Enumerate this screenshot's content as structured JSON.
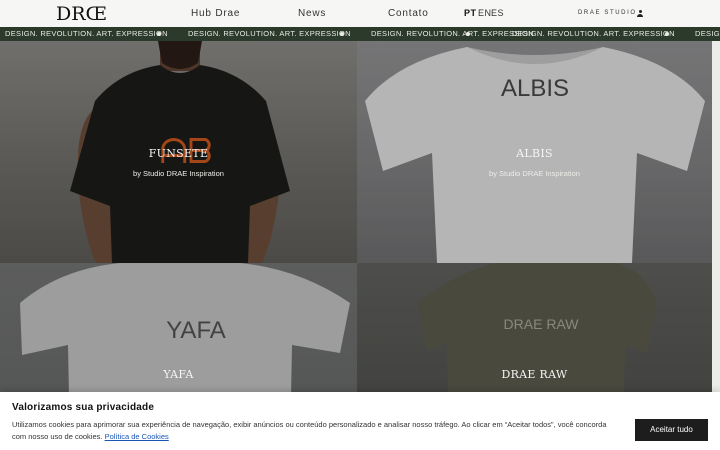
{
  "header": {
    "logo": "DRŒ",
    "nav": [
      {
        "label": "Hub Drae"
      },
      {
        "label": "News"
      },
      {
        "label": "Contato"
      }
    ],
    "languages": [
      {
        "label": "PT",
        "active": true
      },
      {
        "label": "EN",
        "active": false
      },
      {
        "label": "ES",
        "active": false
      }
    ],
    "studio_label": "DRAE STUDIO",
    "account_icon": "user-icon"
  },
  "marquee": {
    "text": "DESIGN. REVOLUTION. ART. EXPRESSION",
    "text_cut": "DESIG",
    "background": "#2b3a2b"
  },
  "products": [
    {
      "name": "FUNSETE",
      "by": "by Studio DRAE Inspiration",
      "print": "ᗩᗷ"
    },
    {
      "name": "ALBIS",
      "by": "by Studio DRAE Inspiration",
      "print": "ALBIS"
    },
    {
      "name": "YAFA",
      "print": "YAFA"
    },
    {
      "name": "DRAE RAW",
      "print": "DRAE RAW"
    }
  ],
  "cookie": {
    "title": "Valorizamos sua privacidade",
    "text": "Utilizamos cookies para aprimorar sua experiência de navegação, exibir anúncios ou conteúdo personalizado e analisar nosso tráfego. Ao clicar em “Aceitar todos”, você concorda com nosso uso de cookies.",
    "link": "Política de Cookies",
    "accept_label": "Aceitar tudo"
  },
  "colors": {
    "accent_dark": "#1d1d1d",
    "marquee_bg": "#2b3a2b",
    "link": "#1a56b8",
    "funsete_print": "#c8561e"
  }
}
